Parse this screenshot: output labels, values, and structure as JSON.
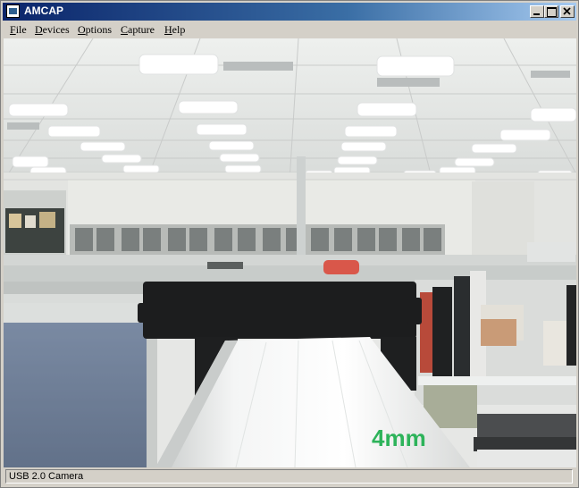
{
  "window": {
    "title": "AMCAP"
  },
  "menu": [
    {
      "pre": "",
      "key": "F",
      "rest": "ile"
    },
    {
      "pre": "",
      "key": "D",
      "rest": "evices"
    },
    {
      "pre": "",
      "key": "O",
      "rest": "ptions"
    },
    {
      "pre": "",
      "key": "C",
      "rest": "apture"
    },
    {
      "pre": "",
      "key": "H",
      "rest": "elp"
    }
  ],
  "preview": {
    "overlay_text": "4mm"
  },
  "status": {
    "text": "USB 2.0 Camera"
  },
  "icons": [
    "app-icon",
    "minimize-icon",
    "maximize-icon",
    "close-icon"
  ]
}
